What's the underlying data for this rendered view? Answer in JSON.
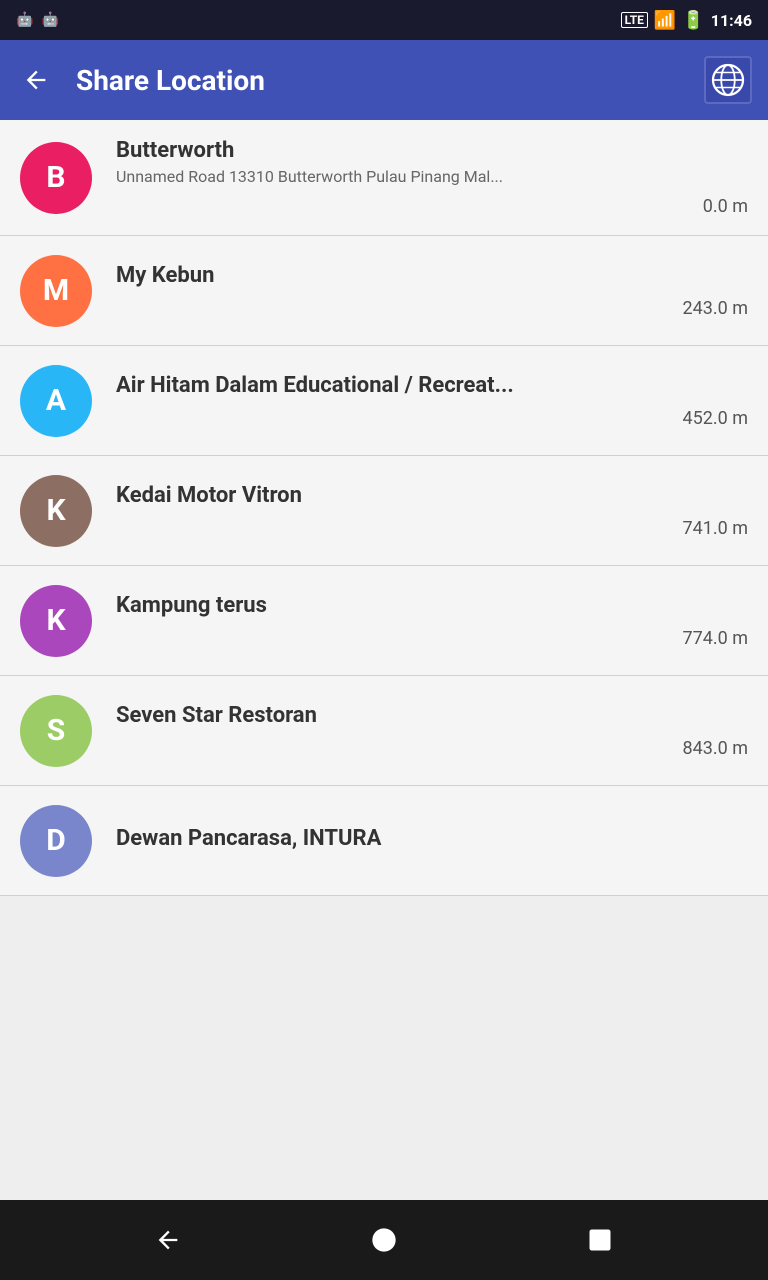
{
  "statusBar": {
    "lte": "LTE",
    "time": "11:46"
  },
  "appBar": {
    "title": "Share Location",
    "backLabel": "←",
    "globeAlt": "Globe Icon"
  },
  "locations": [
    {
      "id": 1,
      "initial": "B",
      "name": "Butterworth",
      "address": "Unnamed Road 13310 Butterworth Pulau Pinang Mal...",
      "distance": "0.0 m",
      "avatarColor": "#e91e63"
    },
    {
      "id": 2,
      "initial": "M",
      "name": "My Kebun",
      "address": "",
      "distance": "243.0 m",
      "avatarColor": "#ff7043"
    },
    {
      "id": 3,
      "initial": "A",
      "name": "Air Hitam Dalam Educational / Recreat...",
      "address": "",
      "distance": "452.0 m",
      "avatarColor": "#29b6f6"
    },
    {
      "id": 4,
      "initial": "K",
      "name": "Kedai Motor Vitron",
      "address": "",
      "distance": "741.0 m",
      "avatarColor": "#8d6e63"
    },
    {
      "id": 5,
      "initial": "K",
      "name": "Kampung terus",
      "address": "",
      "distance": "774.0 m",
      "avatarColor": "#ab47bc"
    },
    {
      "id": 6,
      "initial": "S",
      "name": "Seven Star Restoran",
      "address": "",
      "distance": "843.0 m",
      "avatarColor": "#9ccc65"
    },
    {
      "id": 7,
      "initial": "D",
      "name": "Dewan Pancarasa, INTURA",
      "address": "",
      "distance": "",
      "avatarColor": "#7986cb"
    }
  ],
  "navBar": {
    "backLabel": "Back",
    "homeLabel": "Home",
    "recentLabel": "Recent"
  }
}
